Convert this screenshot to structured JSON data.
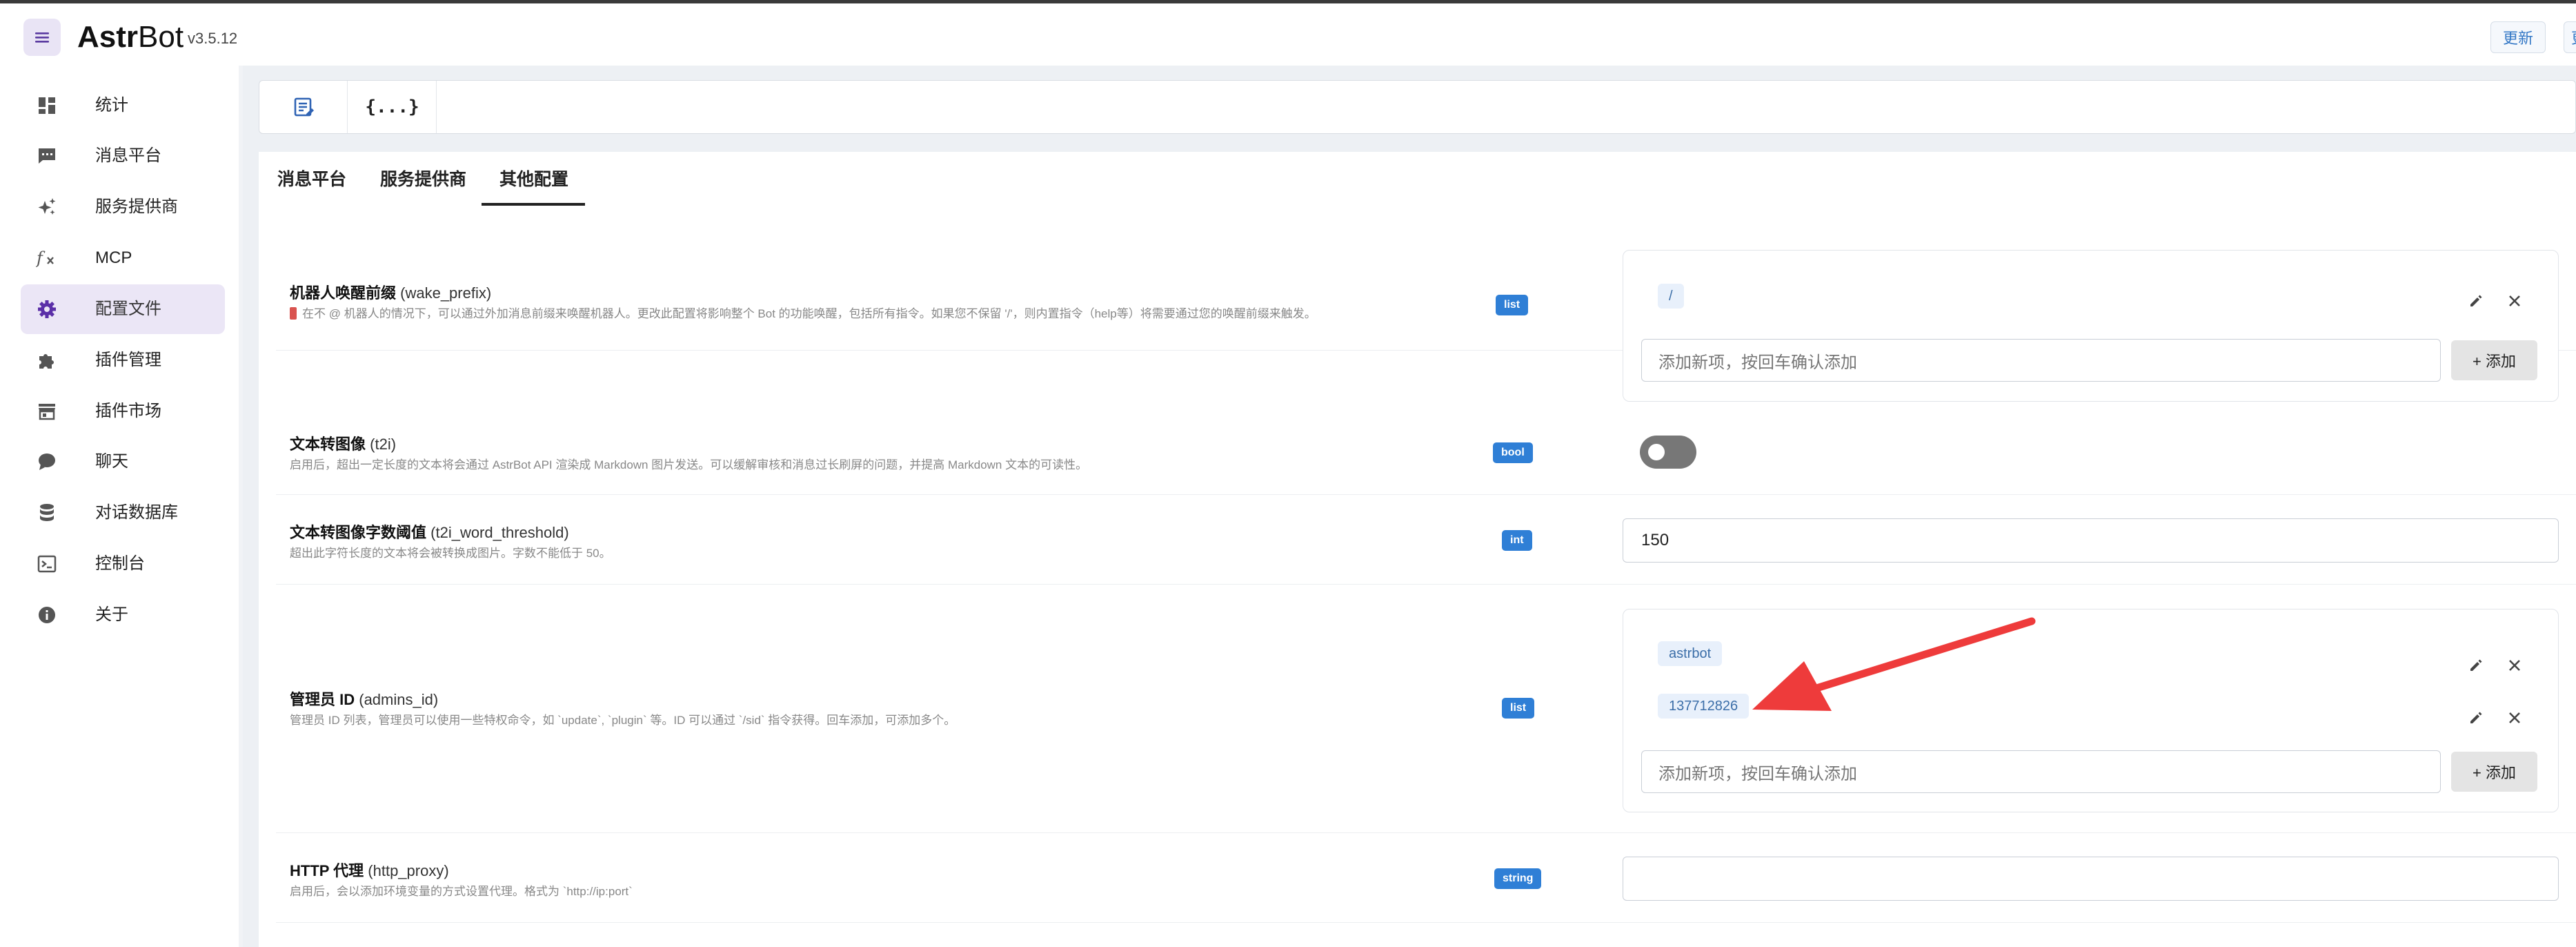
{
  "app": {
    "brand_bold": "Astr",
    "brand_rest": "Bot",
    "version": "v3.5.12",
    "update_label": "更新",
    "update_label_2": "更"
  },
  "sidebar": {
    "items": [
      {
        "label": "统计",
        "icon": "dashboard-icon"
      },
      {
        "label": "消息平台",
        "icon": "chat-icon"
      },
      {
        "label": "服务提供商",
        "icon": "sparkle-icon"
      },
      {
        "label": "MCP",
        "icon": "function-icon"
      },
      {
        "label": "配置文件",
        "icon": "gear-icon",
        "active": true
      },
      {
        "label": "插件管理",
        "icon": "puzzle-icon"
      },
      {
        "label": "插件市场",
        "icon": "store-icon"
      },
      {
        "label": "聊天",
        "icon": "bubble-icon"
      },
      {
        "label": "对话数据库",
        "icon": "database-icon"
      },
      {
        "label": "控制台",
        "icon": "console-icon"
      },
      {
        "label": "关于",
        "icon": "info-icon"
      }
    ]
  },
  "toolbar": {
    "code_label": "{...}"
  },
  "tabs": [
    "消息平台",
    "服务提供商",
    "其他配置"
  ],
  "active_tab": 2,
  "settings": {
    "wake_prefix": {
      "title": "机器人唤醒前缀",
      "key": "(wake_prefix)",
      "desc": "在不 @ 机器人的情况下，可以通过外加消息前缀来唤醒机器人。更改此配置将影响整个 Bot 的功能唤醒，包括所有指令。如果您不保留 '/'，则内置指令（help等）将需要通过您的唤醒前缀来触发。",
      "type": "list",
      "items": [
        "/"
      ],
      "add_placeholder": "添加新项，按回车确认添加",
      "add_label": "+ 添加"
    },
    "t2i": {
      "title": "文本转图像",
      "key": "(t2i)",
      "desc": "启用后，超出一定长度的文本将会通过 AstrBot API 渲染成 Markdown 图片发送。可以缓解审核和消息过长刷屏的问题，并提高 Markdown 文本的可读性。",
      "type": "bool",
      "value": false
    },
    "t2i_word_threshold": {
      "title": "文本转图像字数阈值",
      "key": "(t2i_word_threshold)",
      "desc": "超出此字符长度的文本将会被转换成图片。字数不能低于 50。",
      "type": "int",
      "value": "150"
    },
    "admins_id": {
      "title": "管理员 ID",
      "key": "(admins_id)",
      "desc": "管理员 ID 列表，管理员可以使用一些特权命令，如 `update`, `plugin` 等。ID 可以通过 `/sid` 指令获得。回车添加，可添加多个。",
      "type": "list",
      "items": [
        "astrbot",
        "137712826"
      ],
      "add_placeholder": "添加新项，按回车确认添加",
      "add_label": "+ 添加"
    },
    "http_proxy": {
      "title": "HTTP 代理",
      "key": "(http_proxy)",
      "desc": "启用后，会以添加环境变量的方式设置代理。格式为 `http://ip:port`",
      "type": "string",
      "value": ""
    }
  },
  "colors": {
    "accent": "#6a3fb5",
    "badge": "#2f7fd6",
    "arrow": "#ee3b3b"
  }
}
